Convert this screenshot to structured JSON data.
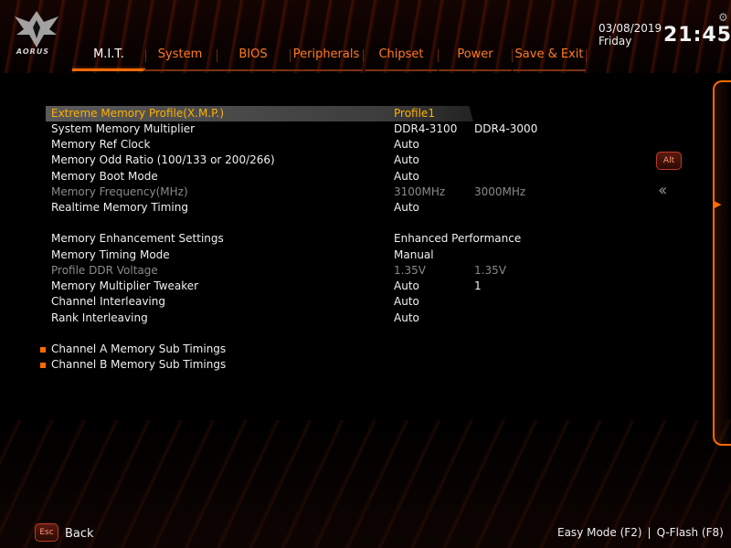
{
  "brand": {
    "logo_text": "AORUS"
  },
  "datetime": {
    "date": "03/08/2019",
    "day": "Friday",
    "time": "21:45"
  },
  "tabs": [
    {
      "label": "M.I.T.",
      "active": true
    },
    {
      "label": "System",
      "active": false
    },
    {
      "label": "BIOS",
      "active": false
    },
    {
      "label": "Peripherals",
      "active": false
    },
    {
      "label": "Chipset",
      "active": false
    },
    {
      "label": "Power",
      "active": false
    },
    {
      "label": "Save & Exit",
      "active": false
    }
  ],
  "settings": [
    {
      "label": "Extreme Memory Profile(X.M.P.)",
      "value1": "Profile1",
      "value2": "",
      "selected": true,
      "dimmed": false
    },
    {
      "label": "System Memory Multiplier",
      "value1": "DDR4-3100",
      "value2": "DDR4-3000",
      "selected": false,
      "dimmed": false
    },
    {
      "label": "Memory Ref Clock",
      "value1": "Auto",
      "value2": "",
      "selected": false,
      "dimmed": false
    },
    {
      "label": "Memory Odd Ratio (100/133 or 200/266)",
      "value1": "Auto",
      "value2": "",
      "selected": false,
      "dimmed": false
    },
    {
      "label": "Memory Boot Mode",
      "value1": "Auto",
      "value2": "",
      "selected": false,
      "dimmed": false
    },
    {
      "label": "Memory Frequency(MHz)",
      "value1": "3100MHz",
      "value2": "3000MHz",
      "selected": false,
      "dimmed": true
    },
    {
      "label": "Realtime Memory Timing",
      "value1": "Auto",
      "value2": "",
      "selected": false,
      "dimmed": false
    },
    {
      "label": "Memory Enhancement Settings",
      "value1": "Enhanced Performance",
      "value2": "",
      "selected": false,
      "dimmed": false
    },
    {
      "label": "Memory Timing Mode",
      "value1": "Manual",
      "value2": "",
      "selected": false,
      "dimmed": false
    },
    {
      "label": "Profile DDR Voltage",
      "value1": "1.35V",
      "value2": "1.35V",
      "selected": false,
      "dimmed": true
    },
    {
      "label": "Memory Multiplier Tweaker",
      "value1": "Auto",
      "value2": "1",
      "selected": false,
      "dimmed": false
    },
    {
      "label": "Channel Interleaving",
      "value1": "Auto",
      "value2": "",
      "selected": false,
      "dimmed": false
    },
    {
      "label": "Rank Interleaving",
      "value1": "Auto",
      "value2": "",
      "selected": false,
      "dimmed": false
    }
  ],
  "submenus": [
    {
      "label": "Channel A Memory Sub Timings"
    },
    {
      "label": "Channel B Memory Sub Timings"
    }
  ],
  "side": {
    "alt_key": "Alt"
  },
  "footer": {
    "esc_key": "Esc",
    "back_label": "Back",
    "easy_mode": "Easy Mode (F2)",
    "separator": "|",
    "qflash": "Q-Flash (F8)"
  },
  "colors": {
    "accent": "#ff6a00",
    "tab_text": "#ff7a22",
    "selected_text": "#ffb000",
    "dim_text": "#8a8a8a"
  }
}
